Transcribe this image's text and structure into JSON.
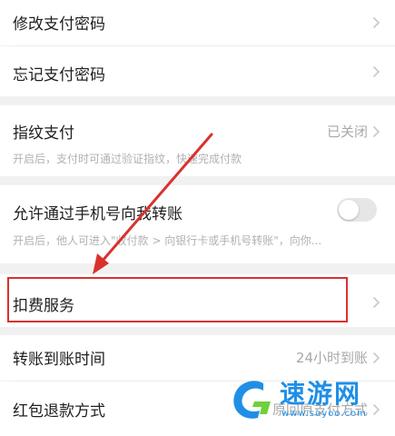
{
  "settings": {
    "modify_pay_password": "修改支付密码",
    "forgot_pay_password": "忘记支付密码",
    "fingerprint_pay": {
      "label": "指纹支付",
      "status": "已关闭",
      "desc": "开启后，支付时可通过验证指纹，快速完成付款"
    },
    "allow_phone_transfer": {
      "label": "允许通过手机号向我转账",
      "enabled": false,
      "desc": "开启后，他人可进入\"收付款 > 向银行卡或手机号转账\"，向你..."
    },
    "deduction_services": "扣费服务",
    "transfer_arrival_time": {
      "label": "转账到账时间",
      "value": "24小时到账"
    },
    "red_packet_refund": {
      "label": "红包退款方式",
      "value": "原回原支付方式"
    }
  },
  "watermark": {
    "brand": "速游网",
    "url": "www.suyoo.com"
  },
  "colors": {
    "highlight": "#d9322e",
    "background": "#f1f1f1",
    "watermark": "#1f8fe6"
  }
}
